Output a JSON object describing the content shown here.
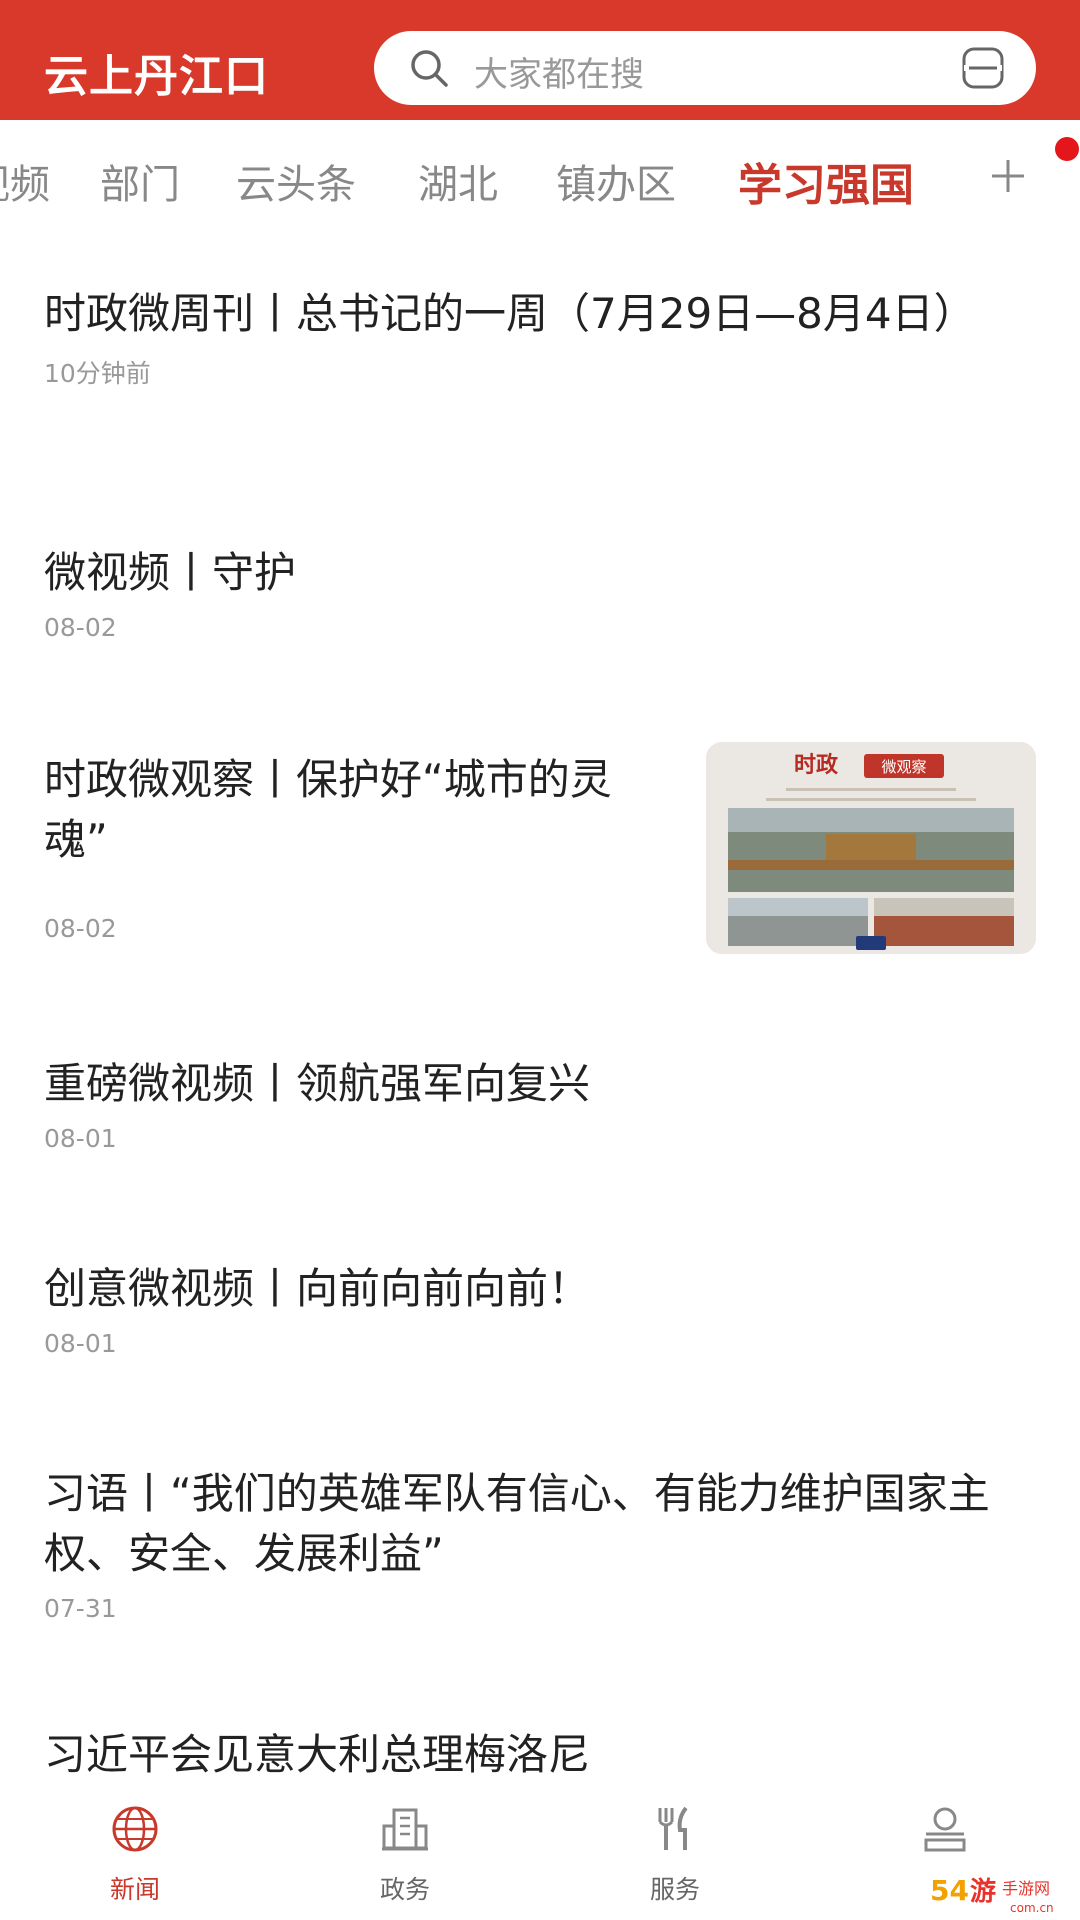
{
  "header": {
    "title": "云上丹江口",
    "search_placeholder": "大家都在搜",
    "search_icon": "search-icon",
    "scan_icon": "scan-icon"
  },
  "tabs": [
    {
      "label": "视频"
    },
    {
      "label": "部门"
    },
    {
      "label": "云头条"
    },
    {
      "label": "湖北"
    },
    {
      "label": "镇办区"
    },
    {
      "label": "学习强国",
      "active": true
    }
  ],
  "tab_add_icon": "plus-icon",
  "news": [
    {
      "title": "时政微周刊丨总书记的一周（7月29日—8月4日）",
      "time": "10分钟前"
    },
    {
      "title": "微视频丨守护",
      "time": "08-02"
    },
    {
      "title": "时政微观察丨保护好“城市的灵魂”",
      "time": "08-02",
      "thumb": {
        "heading": "时政",
        "badge": "微观察"
      }
    },
    {
      "title": "重磅微视频丨领航强军向复兴",
      "time": "08-01"
    },
    {
      "title": "创意微视频丨向前向前向前！",
      "time": "08-01"
    },
    {
      "title": "习语丨“我们的英雄军队有信心、有能力维护国家主权、安全、发展利益”",
      "time": "07-31"
    },
    {
      "title": "习近平会见意大利总理梅洛尼",
      "time": ""
    }
  ],
  "bottom_nav": [
    {
      "label": "新闻",
      "icon": "globe-icon",
      "active": true
    },
    {
      "label": "政务",
      "icon": "building-icon"
    },
    {
      "label": "服务",
      "icon": "fork-knife-icon"
    },
    {
      "label": "",
      "icon": "user-icon"
    }
  ],
  "colors": {
    "brand_red": "#d8392b",
    "active_red": "#c8392b",
    "muted_gray": "#999999"
  },
  "watermark": {
    "text": "54游手游网",
    "url_text": "com.cn"
  }
}
